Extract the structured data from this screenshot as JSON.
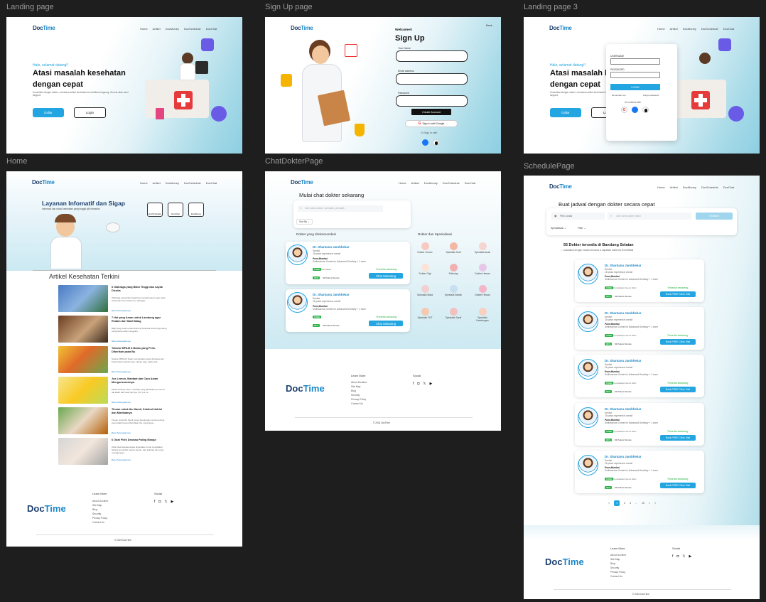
{
  "frames": {
    "landing": "Landing page",
    "signup": "Sign Up page",
    "landing3": "Landing page 3",
    "home": "Home",
    "chat": "ChatDokterPage",
    "schedule": "SchedulePage"
  },
  "brand": {
    "doc": "Doc",
    "time": "Time"
  },
  "nav": [
    "Home",
    "Artikel",
    "DocMoney",
    "DocSchedule",
    "DocChat"
  ],
  "landing": {
    "greeting": "Halo, selamat datang!!",
    "headline1": "Atasi masalah kesehatan",
    "headline2": "dengan cepat",
    "desc": "Konsultasi dengan dokter, membaca artikel kesehatan terverifikasi langsung. Semua akan kami tangani!",
    "daftar": "Daftar",
    "login": "Login"
  },
  "signup": {
    "back": "Back",
    "welcome": "Welcome!!",
    "title": "Sign Up",
    "name_label": "Your Name",
    "email_label": "Email address",
    "password_label": "Password",
    "create": "Create Account",
    "google": "Sign in with Google",
    "or": "Or Sign in with"
  },
  "landing3": {
    "username": "USERNAME",
    "password": "PASSWORD",
    "login": "LOGIN",
    "remember": "Remember me",
    "forgot": "Forgot password",
    "or": "Or continue with"
  },
  "home": {
    "hero_title": "Layanan Infomatif dan Sigap",
    "hero_sub": "Informasi dan solusi kesehatan yang tinggal pilih tersedia!",
    "icons": [
      "DocSchedule",
      "DocChat",
      "DocMoney"
    ],
    "articles_title": "Artikel Kesehatan Terkini",
    "articles": [
      {
        "title": "6 Olahraga yang Bikin Tinggi dan Layak Dicoba",
        "desc": "Olahraga yang bikin tinggi bisa menjadi tujuan agar tetap sehat dan kuat, bukan itu, olahraga...",
        "link": "Baca Selengkapnya"
      },
      {
        "title": "7 Hal yang Aman untuk Lambung agar Redam dari Sakit Maag",
        "desc": "Bagi yang aman untuk lambung bisa jadi solusi bagi orang yang biasa untuk mengeluh...",
        "link": "Baca Selengkapnya"
      },
      {
        "title": "Tekstur MPASI 8 Bulan yang Perlu Diberikan pada Bu",
        "desc": "Tekstur MPASI 8 bulan memerlukan tanpa berbeda dari bulan-bulan sebelumnya. Hanya saja, pada saat...",
        "link": "Baca Selengkapnya"
      },
      {
        "title": "Jus Lemon, Manfaat dan Cara Aman Mengonsumsinya",
        "desc": "Meski rasanya asam, manfaat yang dihasilkan jus lemon tak kalah dari buah lainnya. Pol, jus ini...",
        "link": "Baca Selengkapnya"
      },
      {
        "title": "Tinuan untuk Ibu Hamil, Ketahui Nutrisi dan Manfaatnya",
        "desc": "Tinuan untuk ibu hamil punya kandungan nutrisi penting yang tidak hanya dibutuhkan ibu, tetapi juga...",
        "link": "Baca Selengkapnya"
      },
      {
        "title": "6 Obat Pilek Dewasa Paling Manjur",
        "desc": "Obat pilek dewasa dapat digunakan untuk meredakan hidung tersumbat, bersin-bersin, dan keluhan lain yang mengganggu...",
        "link": "Baca Selengkapnya"
      }
    ]
  },
  "chat": {
    "title": "Mulai chat dokter sekarang",
    "search_placeholder": "Cari nama dokter, spesialis, penyakit...",
    "sort": "Sort By",
    "recommended": "Dokter yang direkomendasi",
    "specialists": "Dokter dan Spesialisasi",
    "specs": [
      "Dokter Umum",
      "Spesialis Kulit",
      "Spesialis Anak",
      "Dokter Gigi",
      "Psikolog",
      "Dokter Hewan",
      "Spesialis Mata",
      "Spesialis Bedah",
      "Dokter Hewan",
      "Spesialis THT",
      "Spesialis Saraf",
      "Spesialis Kandungan"
    ],
    "doctor_name": "Dr. Shantanu Jambhekar",
    "doctor_spec": "Dentist",
    "doctor_exp": "16 years experience overall",
    "doctor_place": "Pune,Mumbai",
    "doctor_clinic": "Smilessence Center for Advanced Dentistry + 1 more",
    "free": "FREE",
    "fee": "Consultation fee at clinic",
    "available": "Tersedia sekarang",
    "cta": "Chat Sekarang",
    "stat": "93 Patient Stories",
    "pct": "99%"
  },
  "schedule": {
    "title": "Buat jadwal dengan dokter secara cepat",
    "location": "Pilih Lokasi",
    "search_placeholder": "Cari nama dokter disini",
    "search_btn": "Search",
    "filter1": "Spesialisasi",
    "filter2": "Filter",
    "count": "55 Dokter tersedia di Bandung Selatan",
    "verified": "Jadwalkan dengan mudah bersama & dapatkan doktermu terverifikasi",
    "doctor_name": "Dr. Shantanu Jambhekar",
    "cta": "Book FREE Clinic Visit",
    "available": "Tersedia sekarang",
    "pages": [
      "<",
      "1",
      "2",
      "3",
      "...",
      "10",
      ">",
      "»"
    ]
  },
  "footer": {
    "learn_more": "Learn More",
    "links": [
      "About Doctime",
      "Site Map",
      "Blog",
      "Security",
      "Privacy Policy",
      "Contact Us"
    ],
    "social": "Social",
    "copyright": "© 2024 DocTime"
  }
}
